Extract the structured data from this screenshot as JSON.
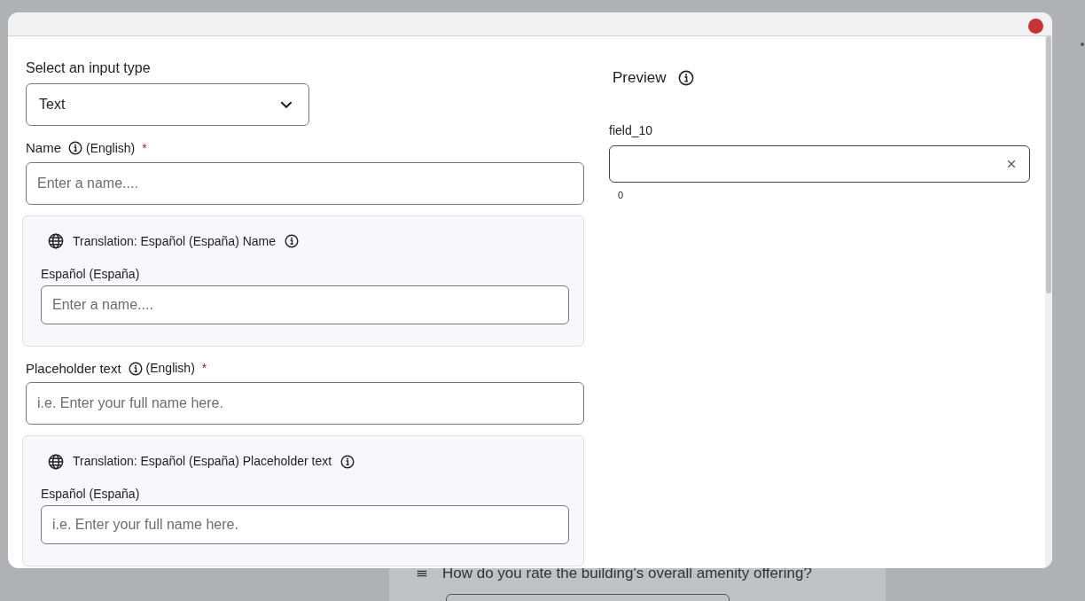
{
  "background": {
    "question": "How do you rate the building's overall amenity offering?"
  },
  "input_type": {
    "label": "Select an input type",
    "value": "Text"
  },
  "fields": [
    {
      "label": "Name",
      "language": "(English)",
      "required_mark": "*",
      "placeholder": "Enter a name....",
      "translation": {
        "title": "Translation: Español (España) Name",
        "label": "Español (España)",
        "placeholder": "Enter a name...."
      }
    },
    {
      "label": "Placeholder text",
      "language": "(English)",
      "required_mark": "*",
      "placeholder": "i.e. Enter your full name here.",
      "translation": {
        "title": "Translation: Español (España) Placeholder text",
        "label": "Español (España)",
        "placeholder": "i.e. Enter your full name here."
      }
    }
  ],
  "preview": {
    "title": "Preview",
    "field_label": "field_10",
    "counter": "0"
  }
}
